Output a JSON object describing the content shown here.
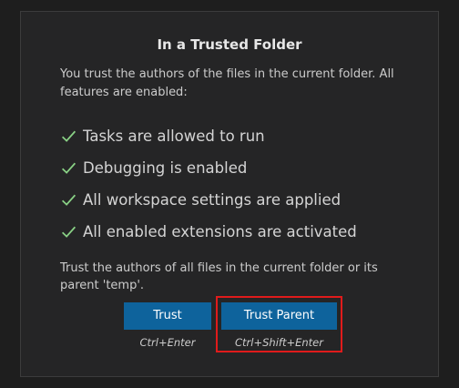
{
  "panel": {
    "title": "In a Trusted Folder",
    "description": "You trust the authors of the files in the current folder. All features are enabled:",
    "features": [
      {
        "label": "Tasks are allowed to run",
        "icon": "check-icon"
      },
      {
        "label": "Debugging is enabled",
        "icon": "check-icon"
      },
      {
        "label": "All workspace settings are applied",
        "icon": "check-icon"
      },
      {
        "label": "All enabled extensions are activated",
        "icon": "check-icon"
      }
    ],
    "prompt": "Trust the authors of all files in the current folder or its parent 'temp'.",
    "buttons": {
      "trust": {
        "label": "Trust",
        "shortcut": "Ctrl+Enter"
      },
      "trust_parent": {
        "label": "Trust Parent",
        "shortcut": "Ctrl+Shift+Enter"
      }
    }
  },
  "colors": {
    "background": "#1e1e1e",
    "panel": "#252526",
    "button": "#0e639c",
    "check": "#89d185",
    "highlight": "#e01b1b"
  }
}
